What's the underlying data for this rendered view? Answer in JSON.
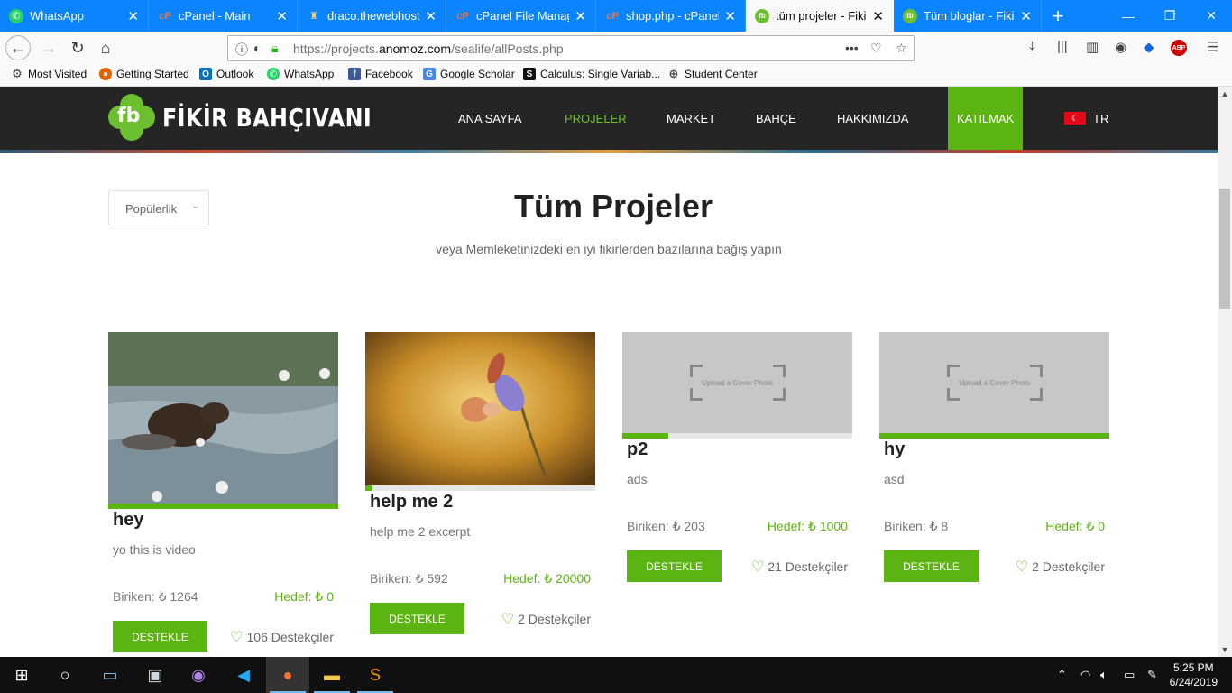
{
  "browser": {
    "tabs": [
      {
        "title": "WhatsApp",
        "icon": "whatsapp-icon"
      },
      {
        "title": "cPanel - Main",
        "icon": "cpanel-icon"
      },
      {
        "title": "draco.thewebhostsе",
        "icon": "castle-icon"
      },
      {
        "title": "cPanel File Manage",
        "icon": "cpanel-icon"
      },
      {
        "title": "shop.php - cPanel F",
        "icon": "cpanel-icon"
      },
      {
        "title": "tüm projeler - Fikir B",
        "icon": "fb-icon",
        "active": true
      },
      {
        "title": "Tüm bloglar - Fikir B",
        "icon": "fb-icon"
      }
    ],
    "url_prefix": "https://projects.",
    "url_domain": "anomoz.com",
    "url_path": "/sealife/allPosts.php",
    "bookmarks": [
      "Most Visited",
      "Getting Started",
      "Outlook",
      "WhatsApp",
      "Facebook",
      "Google Scholar",
      "Calculus: Single Variab...",
      "Student Center"
    ],
    "abp_label": "ABP"
  },
  "site": {
    "logo_text": "FİKİR BAHÇIVANI",
    "logo_mark": "fb",
    "menu": [
      "ANA SAYFA",
      "PROJELER",
      "MARKET",
      "BAHÇE",
      "HAKKIMIZDA",
      "KATILMAK"
    ],
    "active_menu": "PROJELER",
    "lang": "TR"
  },
  "main": {
    "sort_label": "Popülerlik",
    "title": "Tüm Projeler",
    "subtitle": "veya Memleketinizdeki en iyi fikirlerden bazılarına bağış yapın",
    "placeholder_text": "Upload a Cover Photo",
    "support_label": "DESTEKLE",
    "supporters_suffix": "Destekçiler",
    "projects": [
      {
        "title": "hey",
        "excerpt": "yo this is video",
        "raised": "Biriken: ₺ 1264",
        "goal": "Hedef: ₺ 0",
        "supporters": "106 Destekçiler",
        "progress": 1.0,
        "image": "bear-river-photo"
      },
      {
        "title": "help me 2",
        "excerpt": "help me 2 excerpt",
        "raised": "Biriken: ₺ 592",
        "goal": "Hedef: ₺ 20000",
        "supporters": "2 Destekçiler",
        "progress": 0.03,
        "image": "butterfly-photo"
      },
      {
        "title": "p2",
        "excerpt": "ads",
        "raised": "Biriken: ₺ 203",
        "goal": "Hedef: ₺ 1000",
        "supporters": "21 Destekçiler",
        "progress": 0.2,
        "image": "placeholder"
      },
      {
        "title": "hy",
        "excerpt": "asd",
        "raised": "Biriken: ₺ 8",
        "goal": "Hedef: ₺ 0",
        "supporters": "2 Destekçiler",
        "progress": 1.0,
        "image": "placeholder"
      }
    ]
  },
  "taskbar": {
    "time": "5:25 PM",
    "date": "6/24/2019"
  },
  "colors": {
    "accent": "#5cb412",
    "header_bg": "#252525",
    "browser_tab_bar": "#0a84ff"
  }
}
